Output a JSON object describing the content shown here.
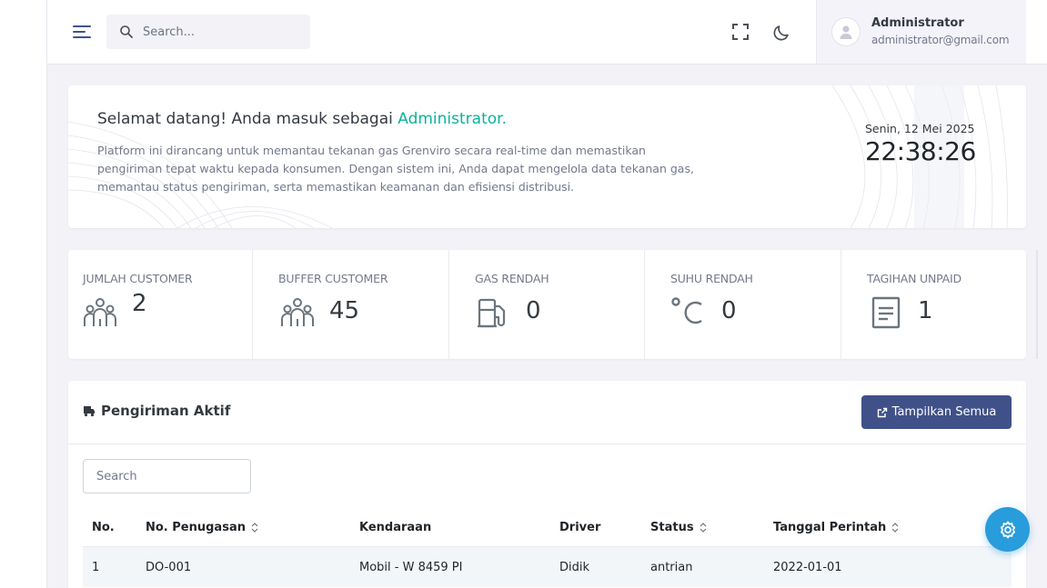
{
  "topbar": {
    "search_placeholder": "Search...",
    "user": {
      "name": "Administrator",
      "email": "administrator@gmail.com"
    }
  },
  "welcome": {
    "title_prefix": "Selamat datang! Anda masuk sebagai ",
    "title_role": "Administrator.",
    "description": "Platform ini dirancang untuk memantau tekanan gas Grenviro secara real-time dan memastikan pengiriman tepat waktu kepada konsumen. Dengan sistem ini, Anda dapat mengelola data tekanan gas, memantau status pengiriman, serta memastikan keamanan dan efisiensi distribusi.",
    "date": "Senin, 12 Mei 2025",
    "time": "22:38:26"
  },
  "stats": [
    {
      "label": "JUMLAH CUSTOMER",
      "value": "2",
      "icon": "group-icon"
    },
    {
      "label": "BUFFER CUSTOMER",
      "value": "45",
      "icon": "group-icon"
    },
    {
      "label": "GAS RENDAH",
      "value": "0",
      "icon": "gas-station-icon"
    },
    {
      "label": "SUHU RENDAH",
      "value": "0",
      "icon": "celsius-icon"
    },
    {
      "label": "TAGIHAN UNPAID",
      "value": "1",
      "icon": "document-icon"
    }
  ],
  "shipments": {
    "title": "Pengiriman Aktif",
    "show_all_label": "Tampilkan Semua",
    "search_placeholder": "Search",
    "columns": [
      "No.",
      "No. Penugasan",
      "Kendaraan",
      "Driver",
      "Status",
      "Tanggal Perintah"
    ],
    "rows": [
      [
        "1",
        "DO-001",
        "Mobil - W 8459 PI",
        "Didik",
        "antrian",
        "2022-01-01"
      ]
    ]
  },
  "colors": {
    "accent": "#0ab39c",
    "primary_button": "#405189",
    "settings_fab": "#299cdb",
    "background": "#f2f2f7"
  }
}
